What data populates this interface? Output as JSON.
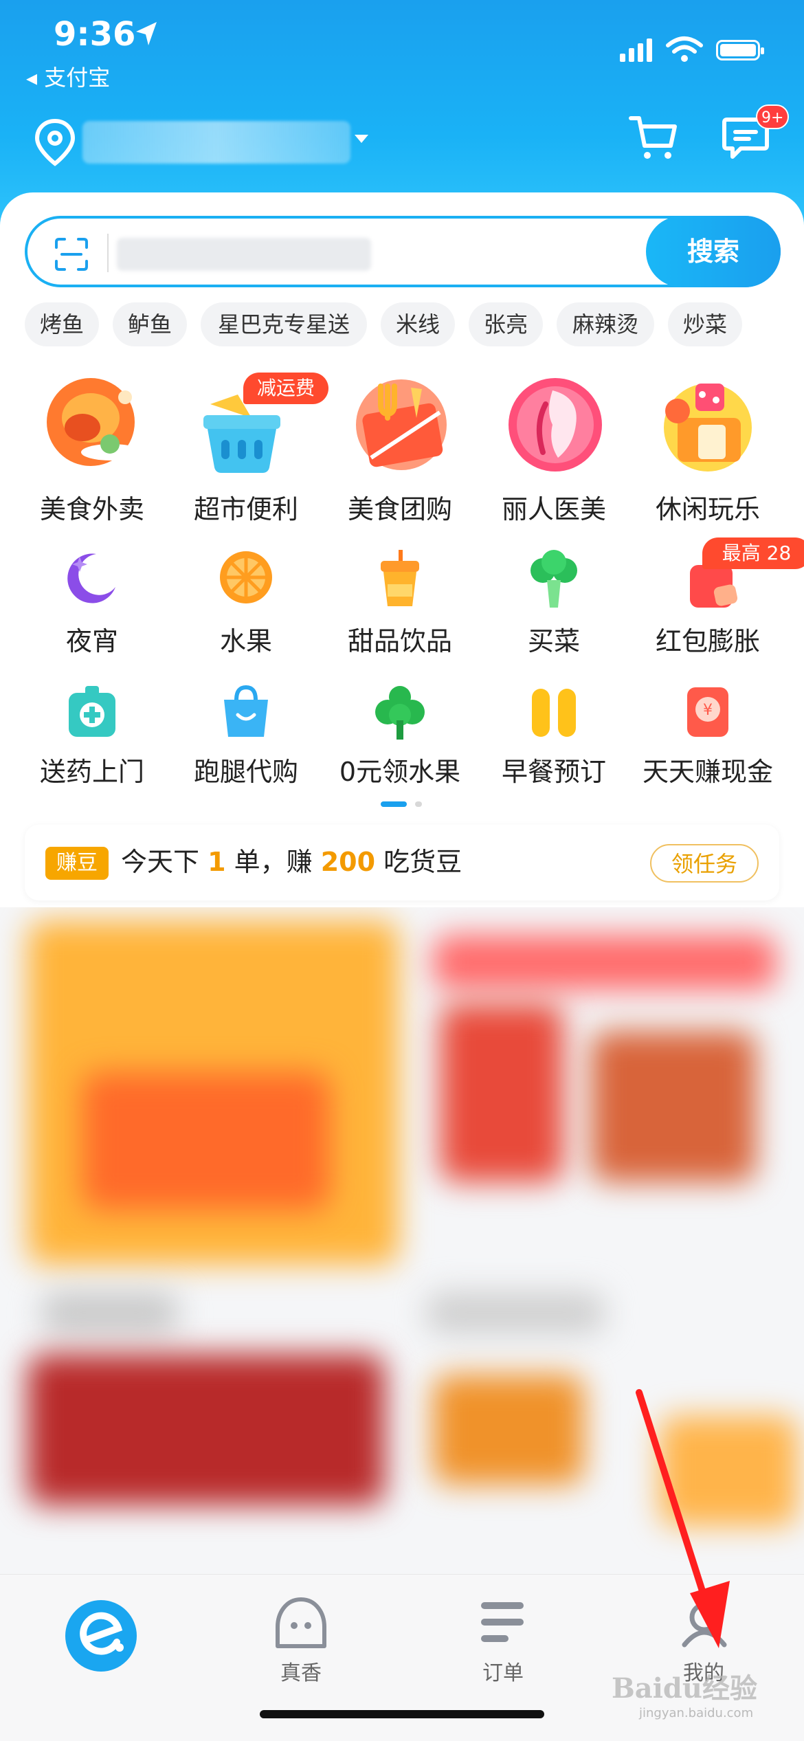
{
  "status_bar": {
    "time": "9:36",
    "back_app": "◂ 支付宝"
  },
  "header": {
    "message_badge": "9+"
  },
  "search": {
    "button_label": "搜索"
  },
  "tags": [
    "烤鱼",
    "鲈鱼",
    "星巴克专星送",
    "米线",
    "张亮",
    "麻辣烫",
    "炒菜"
  ],
  "categories_row1": [
    {
      "label": "美食外卖",
      "icon": "food-delivery-icon"
    },
    {
      "label": "超市便利",
      "icon": "supermarket-basket-icon",
      "badge": "减运费"
    },
    {
      "label": "美食团购",
      "icon": "group-buy-icon"
    },
    {
      "label": "丽人医美",
      "icon": "beauty-icon"
    },
    {
      "label": "休闲玩乐",
      "icon": "leisure-icon"
    }
  ],
  "categories_row2": [
    {
      "label": "夜宵",
      "icon": "moon-icon"
    },
    {
      "label": "水果",
      "icon": "orange-icon"
    },
    {
      "label": "甜品饮品",
      "icon": "drink-cup-icon"
    },
    {
      "label": "买菜",
      "icon": "broccoli-icon"
    },
    {
      "label": "红包膨胀",
      "icon": "red-packet-icon",
      "badge": "最高 28"
    }
  ],
  "categories_row3": [
    {
      "label": "送药上门",
      "icon": "medicine-kit-icon"
    },
    {
      "label": "跑腿代购",
      "icon": "shopping-bag-icon"
    },
    {
      "label": "0元领水果",
      "icon": "tree-icon"
    },
    {
      "label": "早餐预订",
      "icon": "breakfast-icon"
    },
    {
      "label": "天天赚现金",
      "icon": "cash-envelope-icon"
    }
  ],
  "task_banner": {
    "tag": "赚豆",
    "text_a": "今天下 ",
    "text_num1": "1",
    "text_b": " 单，赚 ",
    "text_num2": "200",
    "text_c": " 吃货豆",
    "button": "领任务"
  },
  "tabbar": {
    "tabs": [
      {
        "label": "",
        "icon": "eleme-home-icon"
      },
      {
        "label": "真香",
        "icon": "zhenxiang-icon"
      },
      {
        "label": "订单",
        "icon": "orders-list-icon"
      },
      {
        "label": "我的",
        "icon": "profile-icon"
      }
    ]
  },
  "watermark": {
    "main": "Baidu经验",
    "sub": "jingyan.baidu.com"
  },
  "colors": {
    "brand_blue": "#1aa0ee",
    "accent_orange": "#f39a00",
    "badge_red": "#ff4a2e",
    "arrow_red": "#ff1f1f"
  }
}
